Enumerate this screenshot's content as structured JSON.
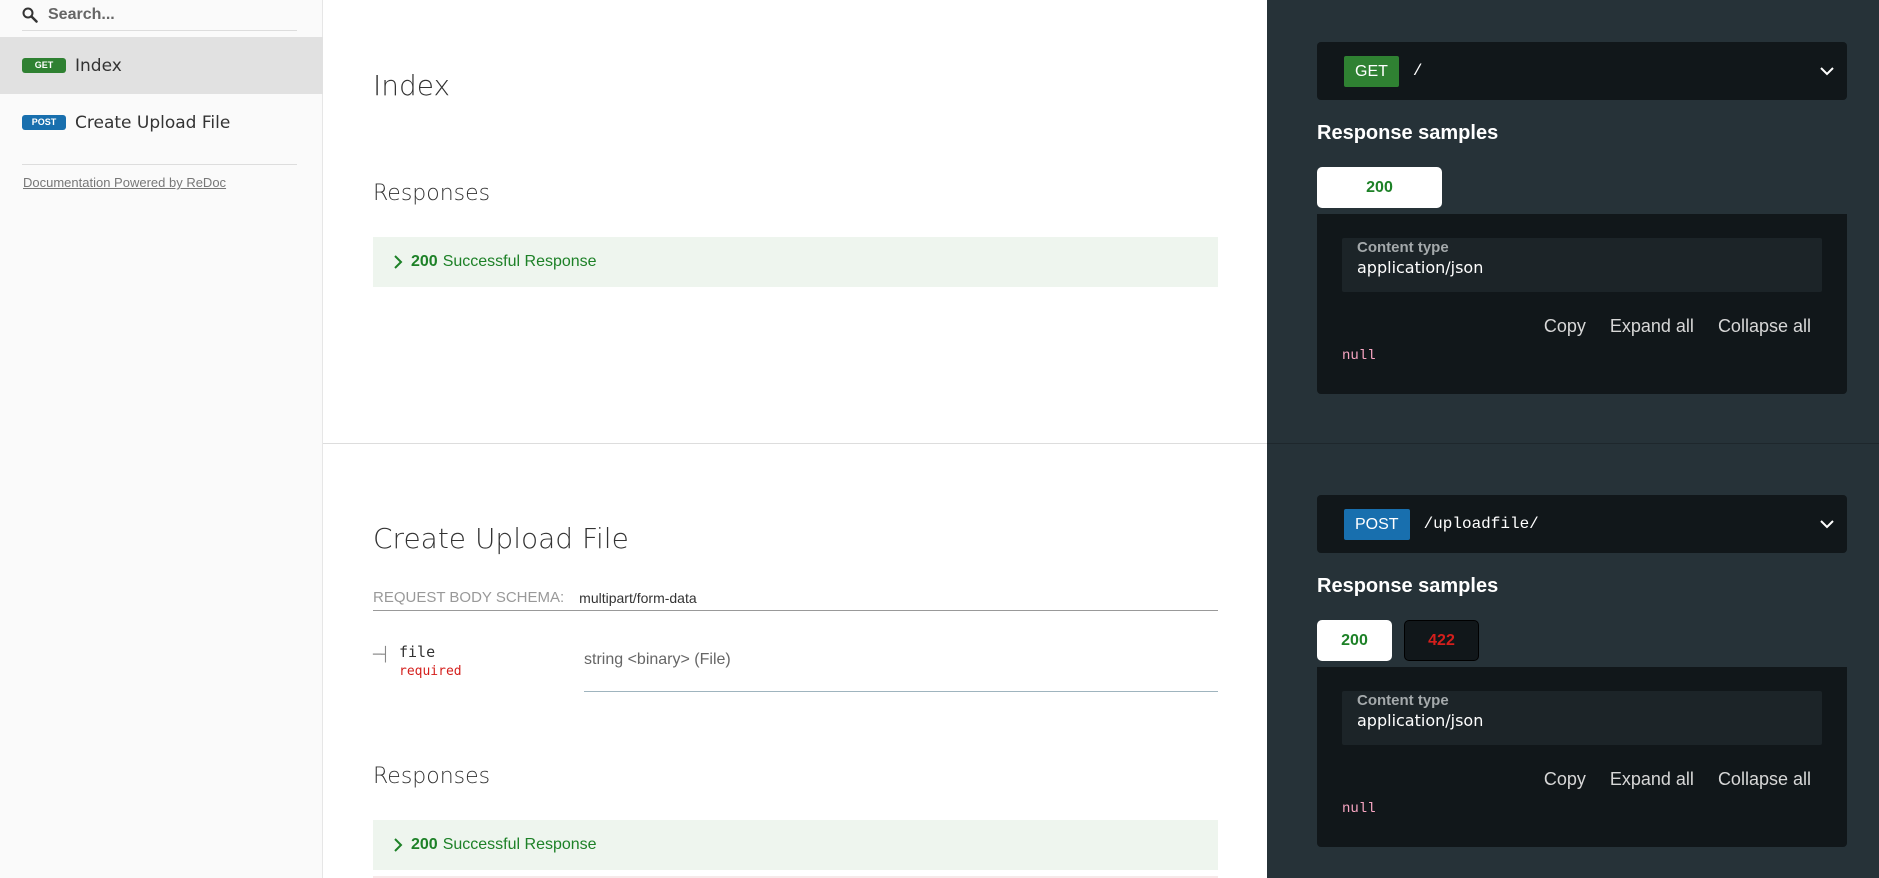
{
  "search": {
    "placeholder": "Search..."
  },
  "sidebar": {
    "items": [
      {
        "method": "GET",
        "label": "Index"
      },
      {
        "method": "POST",
        "label": "Create Upload File"
      }
    ],
    "powered_by": "Documentation Powered by ReDoc"
  },
  "operations": [
    {
      "title": "Index",
      "responses_heading": "Responses",
      "responses": [
        {
          "code": "200",
          "description": "Successful Response"
        }
      ]
    },
    {
      "title": "Create Upload File",
      "request_body_label": "REQUEST BODY SCHEMA:",
      "request_body_type": "multipart/form-data",
      "field": {
        "name": "file",
        "required": "required",
        "type": "string <binary> (File)"
      },
      "responses_heading": "Responses",
      "responses": [
        {
          "code": "200",
          "description": "Successful Response"
        }
      ]
    }
  ],
  "right_panel": [
    {
      "method": "GET",
      "path": "/",
      "samples_title": "Response samples",
      "tabs": [
        "200"
      ],
      "content_type_label": "Content type",
      "content_type": "application/json",
      "actions": {
        "copy": "Copy",
        "expand": "Expand all",
        "collapse": "Collapse all"
      },
      "value": "null"
    },
    {
      "method": "POST",
      "path": "/uploadfile/",
      "samples_title": "Response samples",
      "tabs": [
        "200",
        "422"
      ],
      "content_type_label": "Content type",
      "content_type": "application/json",
      "actions": {
        "copy": "Copy",
        "expand": "Expand all",
        "collapse": "Collapse all"
      },
      "value": "null"
    }
  ],
  "colors": {
    "get": "#2f8132",
    "post": "#186fae",
    "success_text": "#1d8127",
    "error_text": "#d41f1c",
    "right_bg": "#263238",
    "code_bg": "#11171a"
  },
  "icons": {
    "search": "search-icon",
    "chevron_right": "chevron-right-icon",
    "chevron_down": "chevron-down-icon"
  }
}
